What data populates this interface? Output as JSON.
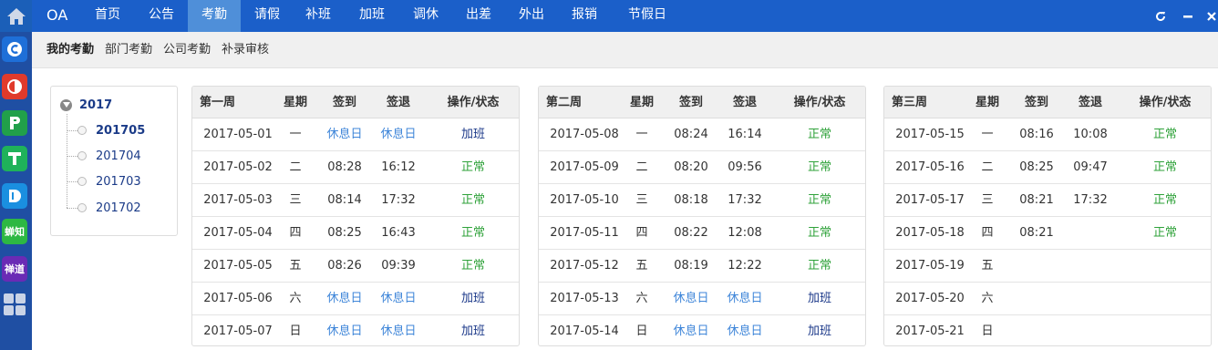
{
  "rail": {
    "apps": [
      {
        "name": "c-app",
        "glyph": "",
        "color": "#1e6fd8"
      },
      {
        "name": "o-app",
        "glyph": "",
        "color": "#e03a2b"
      },
      {
        "name": "p-app",
        "glyph": "",
        "color": "#21a04a"
      },
      {
        "name": "t-app",
        "glyph": "",
        "color": "#1fb25a"
      },
      {
        "name": "d-app",
        "glyph": "",
        "color": "#1a8fe0"
      },
      {
        "name": "chanzhi-app",
        "glyph": "蝉知",
        "color": "#2db843"
      },
      {
        "name": "chandao-app",
        "glyph": "禅道",
        "color": "#6a2bb5"
      }
    ]
  },
  "topnav": {
    "logo": "OA",
    "items": [
      "首页",
      "公告",
      "考勤",
      "请假",
      "补班",
      "加班",
      "调休",
      "出差",
      "外出",
      "报销",
      "节假日"
    ],
    "active_index": 2
  },
  "subnav": {
    "items": [
      "我的考勤",
      "部门考勤",
      "公司考勤",
      "补录审核"
    ],
    "active_index": 0
  },
  "tree": {
    "year": "2017",
    "months": [
      "201705",
      "201704",
      "201703",
      "201702"
    ],
    "selected_index": 0
  },
  "colors": {
    "holiday": "#3f86d9",
    "overtime": "#1d3a8a",
    "normal": "#2fa23a",
    "topbar": "#1b5fc9",
    "active_tab": "#4f8fd9"
  },
  "weeks": [
    {
      "title": "第一周",
      "headers": [
        "星期",
        "签到",
        "签退",
        "操作/状态"
      ],
      "rows": [
        {
          "date": "2017-05-01",
          "day": "一",
          "in": "休息日",
          "out": "休息日",
          "status": "加班"
        },
        {
          "date": "2017-05-02",
          "day": "二",
          "in": "08:28",
          "out": "16:12",
          "status": "正常"
        },
        {
          "date": "2017-05-03",
          "day": "三",
          "in": "08:14",
          "out": "17:32",
          "status": "正常"
        },
        {
          "date": "2017-05-04",
          "day": "四",
          "in": "08:25",
          "out": "16:43",
          "status": "正常"
        },
        {
          "date": "2017-05-05",
          "day": "五",
          "in": "08:26",
          "out": "09:39",
          "status": "正常"
        },
        {
          "date": "2017-05-06",
          "day": "六",
          "in": "休息日",
          "out": "休息日",
          "status": "加班"
        },
        {
          "date": "2017-05-07",
          "day": "日",
          "in": "休息日",
          "out": "休息日",
          "status": "加班"
        }
      ]
    },
    {
      "title": "第二周",
      "headers": [
        "星期",
        "签到",
        "签退",
        "操作/状态"
      ],
      "rows": [
        {
          "date": "2017-05-08",
          "day": "一",
          "in": "08:24",
          "out": "16:14",
          "status": "正常"
        },
        {
          "date": "2017-05-09",
          "day": "二",
          "in": "08:20",
          "out": "09:56",
          "status": "正常"
        },
        {
          "date": "2017-05-10",
          "day": "三",
          "in": "08:18",
          "out": "17:32",
          "status": "正常"
        },
        {
          "date": "2017-05-11",
          "day": "四",
          "in": "08:22",
          "out": "12:08",
          "status": "正常"
        },
        {
          "date": "2017-05-12",
          "day": "五",
          "in": "08:19",
          "out": "12:22",
          "status": "正常"
        },
        {
          "date": "2017-05-13",
          "day": "六",
          "in": "休息日",
          "out": "休息日",
          "status": "加班"
        },
        {
          "date": "2017-05-14",
          "day": "日",
          "in": "休息日",
          "out": "休息日",
          "status": "加班"
        }
      ]
    },
    {
      "title": "第三周",
      "headers": [
        "星期",
        "签到",
        "签退",
        "操作/状态"
      ],
      "rows": [
        {
          "date": "2017-05-15",
          "day": "一",
          "in": "08:16",
          "out": "10:08",
          "status": "正常"
        },
        {
          "date": "2017-05-16",
          "day": "二",
          "in": "08:25",
          "out": "09:47",
          "status": "正常"
        },
        {
          "date": "2017-05-17",
          "day": "三",
          "in": "08:21",
          "out": "17:32",
          "status": "正常"
        },
        {
          "date": "2017-05-18",
          "day": "四",
          "in": "08:21",
          "out": "",
          "status": "正常"
        },
        {
          "date": "2017-05-19",
          "day": "五",
          "in": "",
          "out": "",
          "status": ""
        },
        {
          "date": "2017-05-20",
          "day": "六",
          "in": "",
          "out": "",
          "status": ""
        },
        {
          "date": "2017-05-21",
          "day": "日",
          "in": "",
          "out": "",
          "status": ""
        }
      ]
    }
  ]
}
